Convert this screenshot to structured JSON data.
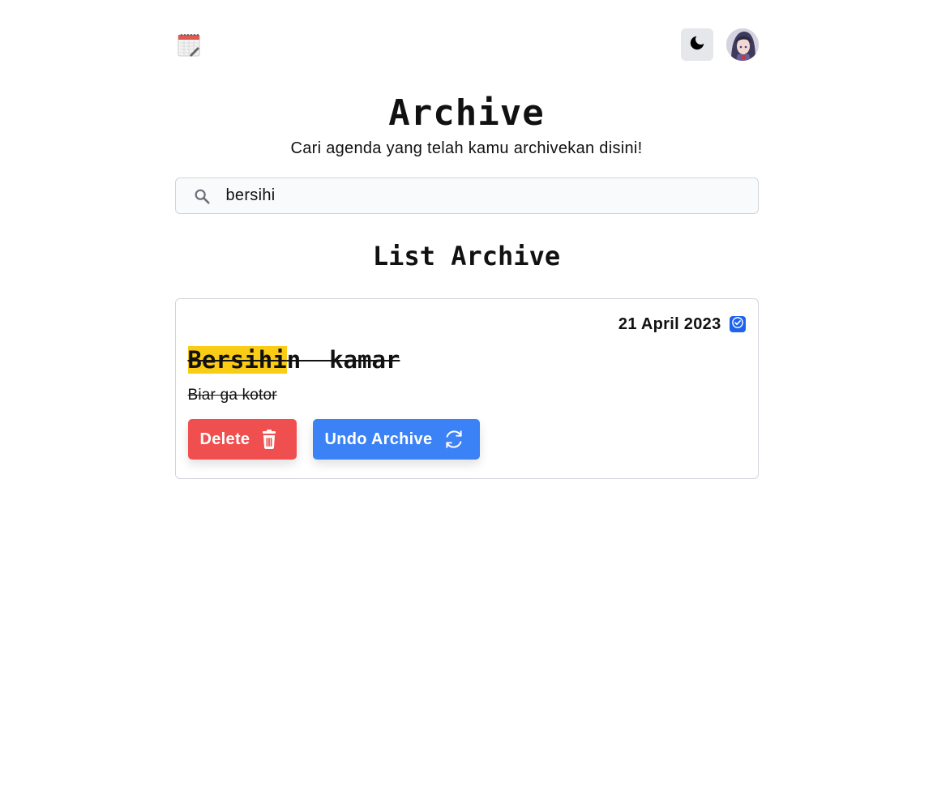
{
  "header": {
    "logo_icon": "calendar-notepad-icon",
    "theme_toggle_icon": "moon-icon",
    "avatar_icon": "user-avatar"
  },
  "page": {
    "title": "Archive",
    "subtitle": "Cari agenda yang telah kamu archivekan disini!"
  },
  "search": {
    "icon": "search-icon",
    "value": "bersihi",
    "placeholder": ""
  },
  "list": {
    "title": "List Archive",
    "items": [
      {
        "date": "21 April 2023",
        "checked": true,
        "title_highlight": "Bersihi",
        "title_rest": "n  kamar",
        "description": "Biar ga kotor",
        "delete_label": "Delete",
        "delete_icon": "trash-icon",
        "undo_label": "Undo Archive",
        "undo_icon": "refresh-icon"
      }
    ]
  },
  "colors": {
    "delete": "#ef4f4f",
    "undo": "#3b82f6",
    "checkbox": "#1d63ed",
    "highlight": "#facc15",
    "toggle_bg": "#e5e7eb"
  }
}
